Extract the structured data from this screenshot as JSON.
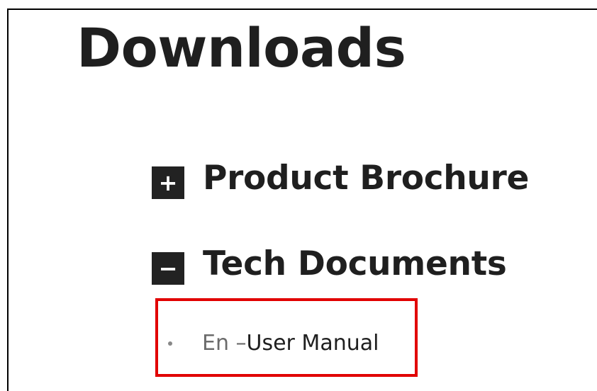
{
  "page": {
    "title": "Downloads"
  },
  "sections": [
    {
      "toggle_symbol": "+",
      "label": "Product Brochure",
      "expanded": false
    },
    {
      "toggle_symbol": "−",
      "label": "Tech Documents",
      "expanded": true,
      "items": [
        {
          "prefix": "En – ",
          "link_label": "User Manual"
        }
      ]
    }
  ],
  "colors": {
    "highlight": "#e10000",
    "toggle_background": "#222222",
    "text": "#1f1f1f",
    "muted_text": "#6b6b6b"
  },
  "icons": {
    "expand": "plus-icon",
    "collapse": "minus-icon",
    "list_marker": "bullet-icon"
  }
}
